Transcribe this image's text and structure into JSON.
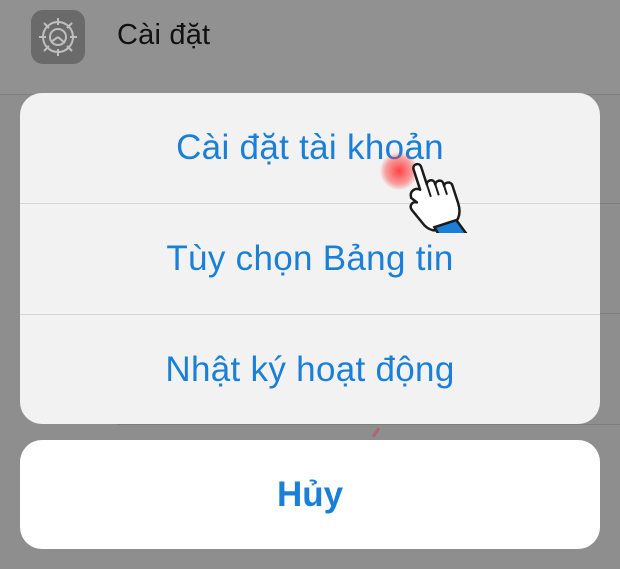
{
  "background": {
    "settings_row": {
      "icon": "gear-icon",
      "label": "Cài đặt"
    }
  },
  "action_sheet": {
    "items": [
      {
        "label": "Cài đặt tài khoản"
      },
      {
        "label": "Tùy chọn Bảng tin"
      },
      {
        "label": "Nhật ký hoạt động"
      }
    ],
    "cancel_label": "Hủy"
  },
  "tap_indicator": {
    "icon": "hand-pointer-icon",
    "color": "#ff3a3a"
  },
  "colors": {
    "accent": "#1a7fd6",
    "sheet_background": "#f2f2f2",
    "overlay": "#8e8e8e"
  }
}
